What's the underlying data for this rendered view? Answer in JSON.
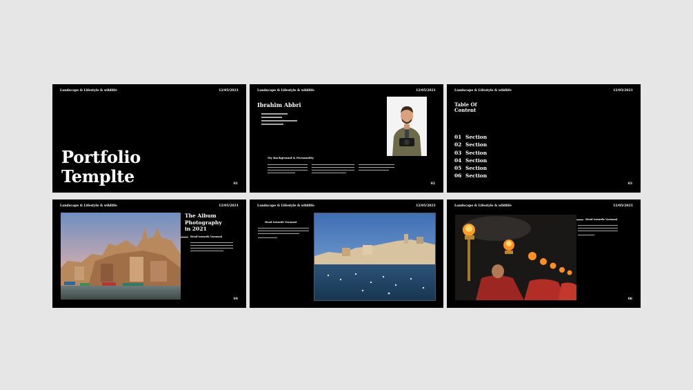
{
  "slides": [
    {
      "header": "Landscape & Lifestyle & wildlife",
      "date": "12/05/2021",
      "title_line1": "Portfolio",
      "title_line2": "Templte",
      "page": "01"
    },
    {
      "header": "Landscape & Lifestyle & wildlife",
      "date": "12/05/2021",
      "name": "Ibrahim Abbri",
      "section_title": "My Background & Personality",
      "page": "02"
    },
    {
      "header": "Landscape & Lifestyle & wildlife",
      "date": "12/05/2021",
      "toc_title_line1": "Table Of",
      "toc_title_line2": "Content",
      "sections": [
        {
          "num": "01",
          "label": "Section"
        },
        {
          "num": "02",
          "label": "Section"
        },
        {
          "num": "03",
          "label": "Section"
        },
        {
          "num": "04",
          "label": "Section"
        },
        {
          "num": "05",
          "label": "Section"
        },
        {
          "num": "06",
          "label": "Section"
        }
      ],
      "page": "03"
    },
    {
      "header": "Landscape & Lifestyle & wildlife",
      "date": "12/05/2021",
      "album_line1": "The Album",
      "album_line2": "Photography",
      "album_line3": "in 2021",
      "subhead": "Head towards Varanasi",
      "page": "04"
    },
    {
      "header": "Landscape & Lifestyle & wildlife",
      "date": "12/05/2021",
      "subhead": "Head towards Varanasi"
    },
    {
      "header": "Landscape & Lifestyle & wildlife",
      "date": "12/05/2021",
      "subhead": "Head towards Varanasi",
      "page": "06"
    }
  ]
}
